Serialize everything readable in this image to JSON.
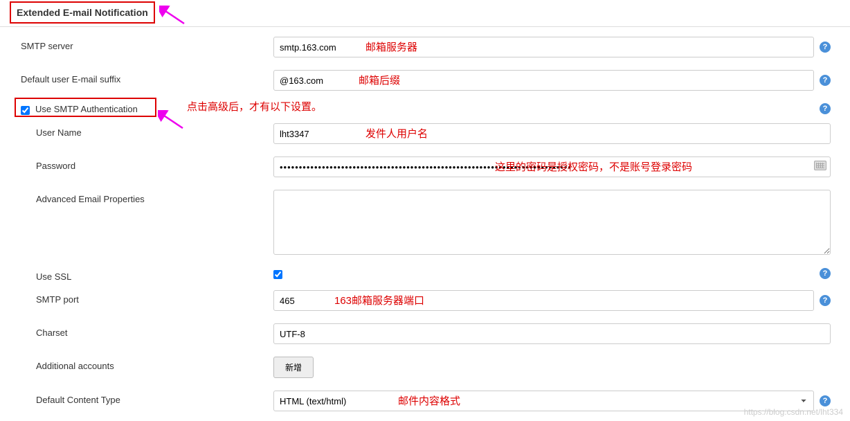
{
  "section": {
    "title": "Extended E-mail Notification"
  },
  "fields": {
    "smtp_server": {
      "label": "SMTP server",
      "value": "smtp.163.com"
    },
    "default_suffix": {
      "label": "Default user E-mail suffix",
      "value": "@163.com"
    },
    "use_smtp_auth": {
      "label": "Use SMTP Authentication"
    },
    "user_name": {
      "label": "User Name",
      "value": "lht3347"
    },
    "password": {
      "label": "Password",
      "value": "••••••••••••••••••••••••••••••••••••••••••••••••••••••••••••••••••••••••••••"
    },
    "adv_props": {
      "label": "Advanced Email Properties",
      "value": ""
    },
    "use_ssl": {
      "label": "Use SSL"
    },
    "smtp_port": {
      "label": "SMTP port",
      "value": "465"
    },
    "charset": {
      "label": "Charset",
      "value": "UTF-8"
    },
    "additional_accounts": {
      "label": "Additional accounts",
      "button": "新增"
    },
    "default_content_type": {
      "label": "Default Content Type",
      "selected": "HTML (text/html)"
    }
  },
  "annotations": {
    "smtp_server": "邮箱服务器",
    "suffix": "邮箱后缀",
    "advanced_note": "点击高级后，才有以下设置。",
    "user_name": "发件人用户名",
    "password": "这里的密码是授权密码，不是账号登录密码",
    "port": "163邮箱服务器端口",
    "content_type": "邮件内容格式"
  },
  "watermark": "https://blog.csdn.net/lht334"
}
